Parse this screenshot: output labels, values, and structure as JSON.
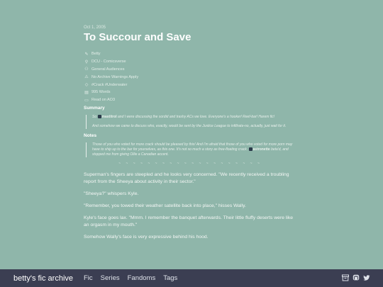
{
  "post": {
    "date": "Oct 1, 2005",
    "title": "To Succour and Save",
    "meta": [
      {
        "icon": "pen-icon",
        "glyph": "✎",
        "text": "Betty"
      },
      {
        "icon": "book-icon",
        "glyph": "⚲",
        "text": "DCU - Comicsverse"
      },
      {
        "icon": "audience-icon",
        "glyph": "⚇",
        "text": "General Audiences"
      },
      {
        "icon": "warning-icon",
        "glyph": "⚠",
        "text": "No Archive Warnings Apply"
      },
      {
        "icon": "tag-icon",
        "glyph": "◇",
        "text": "#Crack #Underwater"
      },
      {
        "icon": "words-icon",
        "glyph": "▤",
        "text": "995 Words"
      },
      {
        "icon": "external-link-icon",
        "glyph": "▭",
        "text": "Read on AO3"
      }
    ],
    "summary": {
      "heading": "Summary",
      "p1_before": "So",
      "p1_mention": "mastitrol",
      "p1_after": "and I were discussing the sordid and trashy ACs we love. Everyone's a hooker! Reef-bar! Harem fic!",
      "p2": "And somehow we came to discuss who, exactly, would be sent by the Justice League to infiltrate-no, actually, just wait for it."
    },
    "notes": {
      "heading": "Notes",
      "p1_before": "Those of you who voted for more crack should be pleased by this! And I'm afraid that those of you who voted for more porn may have to ship up to the bar for yourselves, as this one. It's not so much a story as free-floating crack.",
      "p1_mention": "astronette",
      "p1_after": "beta'd, and stopped me from giving Ollie a Canadian accent."
    },
    "divider": "~ ~ ~ ~ ~ ~ ~ ~ ~ ~ ~ ~ ~ ~ ~ ~ ~ ~ ~ ~",
    "story": [
      "Superman's fingers are steepled and he looks very concerned. \"We recently received a troubling report from the Sheeya about activity in their sector.\"",
      "\"Sheeya?\" whispers Kyle.",
      "\"Remember, you towed their weather satellite back into place,\" hisses Wally.",
      "Kyle's face goes lax. \"Mmm. I remember the banquet afterwards. Their little fluffy deserts were like an orgasm in my mouth.\"",
      "Somehow Wally's face is very expressive behind his hood."
    ]
  },
  "nav": {
    "brand": "betty's fic archive",
    "links": [
      "Fic",
      "Series",
      "Fandoms",
      "Tags"
    ],
    "icons": [
      "archive-icon",
      "mastodon-icon",
      "twitter-icon"
    ]
  }
}
